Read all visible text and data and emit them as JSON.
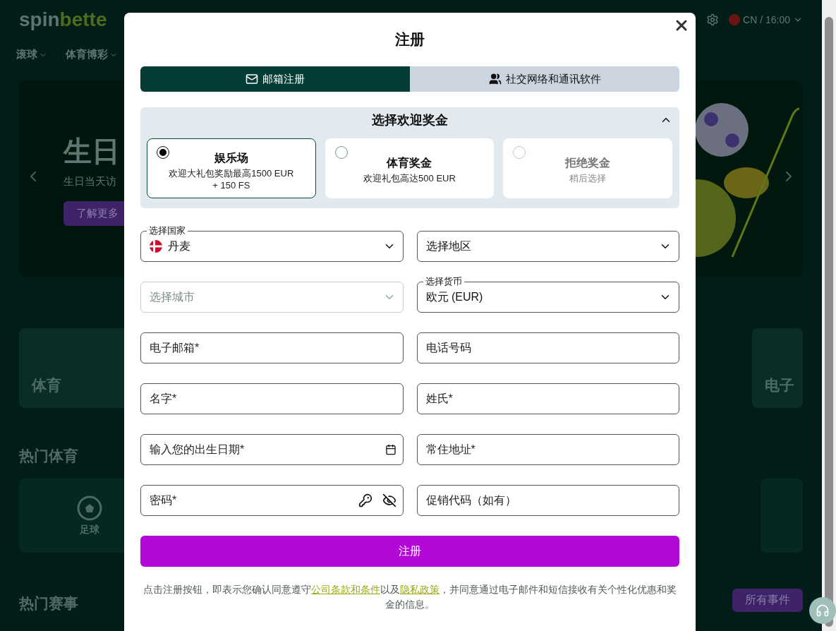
{
  "site": {
    "logo": [
      "spin",
      "bette"
    ],
    "locale": "CN / 16:00",
    "nav": [
      "滚球",
      "体育博彩"
    ],
    "banner": {
      "title": "生日",
      "subtitle": "生日当天访",
      "button": "了解更多"
    },
    "categories": [
      "体育",
      "电子"
    ],
    "hot_sports_title": "热门体育",
    "sports": [
      "足球"
    ],
    "hot_events_title": "热门赛事",
    "all_events": "所有事件"
  },
  "modal": {
    "title": "注册",
    "tabs": [
      {
        "label": "邮箱注册",
        "selected": true,
        "kind": "email"
      },
      {
        "label": "社交网络和通讯软件",
        "selected": false,
        "kind": "social"
      }
    ],
    "bonus": {
      "title": "选择欢迎奖金",
      "expanded": true,
      "options": [
        {
          "title": "娱乐场",
          "description": "欢迎大礼包奖励最高1500 EUR + 150 FS",
          "selected": true,
          "disabled": false
        },
        {
          "title": "体育奖金",
          "description": "欢迎礼包高达500 EUR",
          "selected": false,
          "disabled": false
        },
        {
          "title": "拒绝奖金",
          "description": "稍后选择",
          "selected": false,
          "disabled": true
        }
      ]
    },
    "field_rows": [
      [
        {
          "kind": "country",
          "label": "选择国家",
          "value": "丹麦",
          "disabled": false
        },
        {
          "kind": "select",
          "placeholder": "选择地区",
          "disabled": false
        }
      ],
      [
        {
          "kind": "select",
          "placeholder": "选择城市",
          "disabled": true
        },
        {
          "kind": "select",
          "label": "选择货币",
          "value": "欧元 (EUR)",
          "disabled": false
        }
      ],
      [
        {
          "kind": "text",
          "placeholder": "电子邮箱*"
        },
        {
          "kind": "text",
          "placeholder": "电话号码"
        }
      ],
      [
        {
          "kind": "text",
          "placeholder": "名字*"
        },
        {
          "kind": "text",
          "placeholder": "姓氏*"
        }
      ],
      [
        {
          "kind": "date",
          "placeholder": "输入您的出生日期*"
        },
        {
          "kind": "text",
          "placeholder": "常住地址*"
        }
      ],
      [
        {
          "kind": "password",
          "placeholder": "密码*"
        },
        {
          "kind": "text",
          "placeholder": "促销代码（如有）"
        }
      ]
    ],
    "submit": "注册",
    "legal": [
      {
        "kind": "text",
        "text": "点击注册按钮，即表示您确认同意遵守"
      },
      {
        "kind": "link",
        "text": "公司条款和条件"
      },
      {
        "kind": "text",
        "text": "以及"
      },
      {
        "kind": "link",
        "text": "隐私政策"
      },
      {
        "kind": "text",
        "text": "，并同意通过电子邮件和短信接收有关个性化优惠和奖金的信息。"
      }
    ]
  }
}
